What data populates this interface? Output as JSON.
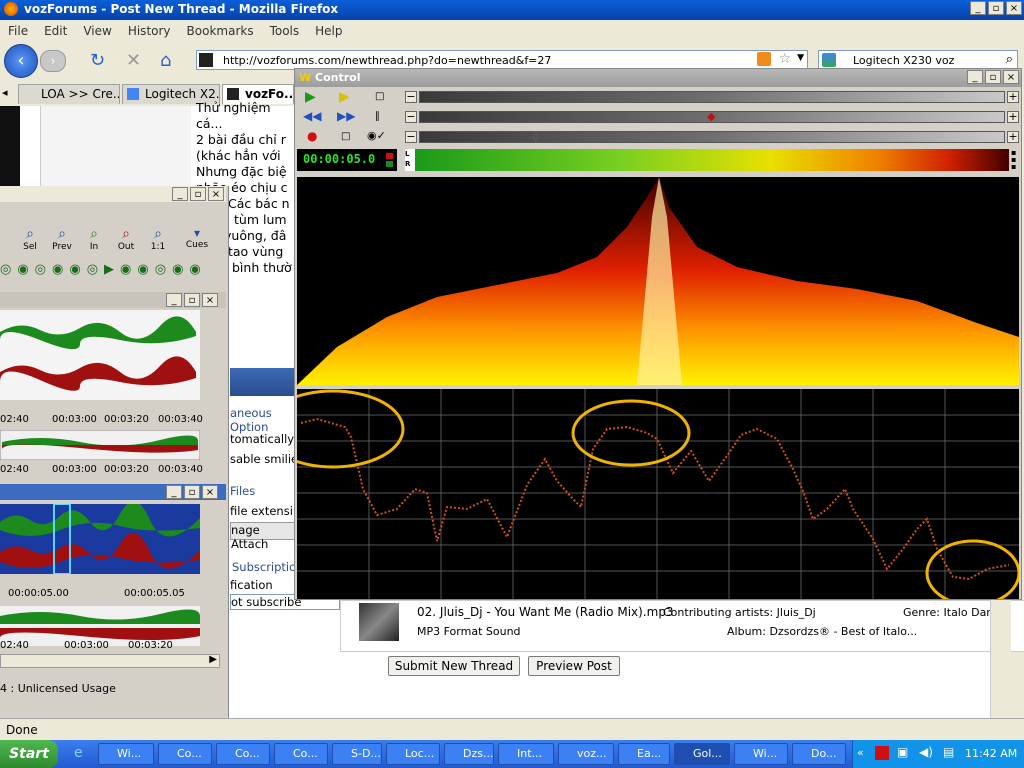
{
  "window": {
    "title": "vozForums - Post New Thread - Mozilla Firefox"
  },
  "menu": [
    "File",
    "Edit",
    "View",
    "History",
    "Bookmarks",
    "Tools",
    "Help"
  ],
  "address": {
    "url": "http://vozforums.com/newthread.php?do=newthread&f=27"
  },
  "search": {
    "value": "Logitech X230 voz"
  },
  "tabs": [
    {
      "label": "LOA >> Cre..."
    },
    {
      "label": "Logitech X2..."
    },
    {
      "label": "vozFo..."
    }
  ],
  "post": {
    "lines": [
      "Thử nghiệm cá...",
      "2 bài đầu chỉ r",
      "(khác hẳn với",
      "Nhưng đặc biệ",
      "nhão éo chịu c",
      "Các bác n",
      "tùm lum",
      "vuông, đâ",
      "tao vùng",
      "bình thườ"
    ]
  },
  "options": {
    "misc": "aneous Option",
    "auto": "tomatically",
    "smilies": "sable smilie",
    "files": "Files",
    "ext": "file extensi",
    "attach": "nage Attach",
    "subscr": "Subscription",
    "notif": "fication Type",
    "notsub": "ot subscribe"
  },
  "buttons": {
    "submit": "Submit New Thread",
    "preview": "Preview Post"
  },
  "player": {
    "title": "Control",
    "time": "00:00:05.0",
    "lr": [
      "L",
      "R"
    ],
    "track": "02. Jluis_Dj - You Want Me (Radio Mix).mp3",
    "artists": "Contributing artists: Jluis_Dj",
    "genre": "Genre: Italo Dance",
    "format": "MP3 Format Sound",
    "album": "Album: Dzsordzs® - Best of Italo..."
  },
  "editor": {
    "tools": [
      "Sel",
      "Prev",
      "In",
      "Out",
      "1:1",
      "Cues"
    ],
    "t1": [
      "02:40",
      "00:03:00",
      "00:03:20",
      "00:03:40"
    ],
    "t2": [
      "02:40",
      "00:03:00",
      "00:03:20",
      "00:03:40"
    ],
    "t3": [
      "00:00:05.00",
      "00:00:05.05"
    ],
    "t4": [
      "02:40",
      "00:03:00",
      "00:03:20"
    ],
    "status": "4 : Unlicensed Usage"
  },
  "status": {
    "text": "Done"
  },
  "taskbar": {
    "start": "Start",
    "items": [
      "Wi...",
      "Co...",
      "Co...",
      "Co...",
      "S-D...",
      "Loc...",
      "Dzs...",
      "Int...",
      "voz...",
      "Ea...",
      "Gol...",
      "Wi...",
      "Do..."
    ],
    "clock": "11:42 AM"
  },
  "colors": {
    "accent": "#0a5fd8",
    "waveGreen": "#1c8a1c",
    "waveRed": "#a01010",
    "circle": "#f0b400"
  }
}
